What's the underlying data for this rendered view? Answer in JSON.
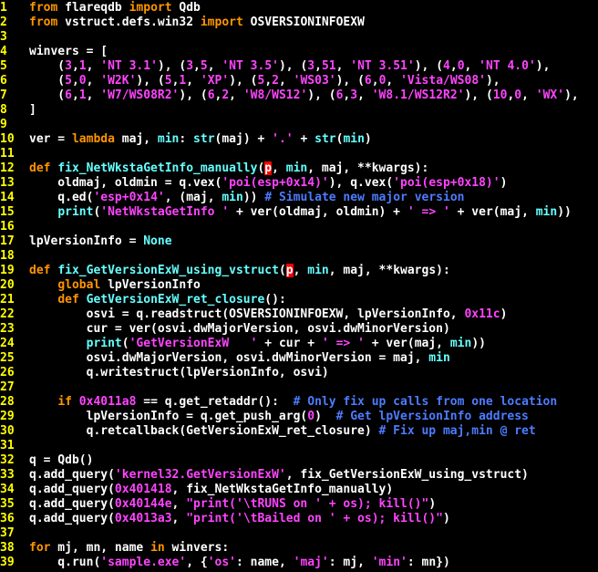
{
  "editor": {
    "background": "#000000",
    "colors": {
      "line_number": "#ffff00",
      "keyword": "#ff9500",
      "string": "#ff44ff",
      "function": "#66ffff",
      "comment": "#4d7cff",
      "text": "#ffffff",
      "cursor": "#ff0000"
    },
    "lines": [
      {
        "n": "1",
        "tokens": [
          {
            "t": "from",
            "c": "kw"
          },
          {
            "t": " flareqdb ",
            "c": "nm"
          },
          {
            "t": "import",
            "c": "kw"
          },
          {
            "t": " Qdb",
            "c": "nm"
          }
        ]
      },
      {
        "n": "2",
        "tokens": [
          {
            "t": "from",
            "c": "kw"
          },
          {
            "t": " vstruct.defs.win32 ",
            "c": "nm"
          },
          {
            "t": "import",
            "c": "kw"
          },
          {
            "t": " OSVERSIONINFOEXW",
            "c": "nm"
          }
        ]
      },
      {
        "n": "3",
        "tokens": []
      },
      {
        "n": "4",
        "tokens": [
          {
            "t": "winvers = [",
            "c": "nm"
          }
        ]
      },
      {
        "n": "5",
        "tokens": [
          {
            "t": "    (",
            "c": "nm"
          },
          {
            "t": "3",
            "c": "num"
          },
          {
            "t": ",",
            "c": "nm"
          },
          {
            "t": "1",
            "c": "num"
          },
          {
            "t": ", ",
            "c": "nm"
          },
          {
            "t": "'NT 3.1'",
            "c": "str"
          },
          {
            "t": "), (",
            "c": "nm"
          },
          {
            "t": "3",
            "c": "num"
          },
          {
            "t": ",",
            "c": "nm"
          },
          {
            "t": "5",
            "c": "num"
          },
          {
            "t": ", ",
            "c": "nm"
          },
          {
            "t": "'NT 3.5'",
            "c": "str"
          },
          {
            "t": "), (",
            "c": "nm"
          },
          {
            "t": "3",
            "c": "num"
          },
          {
            "t": ",",
            "c": "nm"
          },
          {
            "t": "51",
            "c": "num"
          },
          {
            "t": ", ",
            "c": "nm"
          },
          {
            "t": "'NT 3.51'",
            "c": "str"
          },
          {
            "t": "), (",
            "c": "nm"
          },
          {
            "t": "4",
            "c": "num"
          },
          {
            "t": ",",
            "c": "nm"
          },
          {
            "t": "0",
            "c": "num"
          },
          {
            "t": ", ",
            "c": "nm"
          },
          {
            "t": "'NT 4.0'",
            "c": "str"
          },
          {
            "t": "),",
            "c": "nm"
          }
        ]
      },
      {
        "n": "6",
        "tokens": [
          {
            "t": "    (",
            "c": "nm"
          },
          {
            "t": "5",
            "c": "num"
          },
          {
            "t": ",",
            "c": "nm"
          },
          {
            "t": "0",
            "c": "num"
          },
          {
            "t": ", ",
            "c": "nm"
          },
          {
            "t": "'W2K'",
            "c": "str"
          },
          {
            "t": "), (",
            "c": "nm"
          },
          {
            "t": "5",
            "c": "num"
          },
          {
            "t": ",",
            "c": "nm"
          },
          {
            "t": "1",
            "c": "num"
          },
          {
            "t": ", ",
            "c": "nm"
          },
          {
            "t": "'XP'",
            "c": "str"
          },
          {
            "t": "), (",
            "c": "nm"
          },
          {
            "t": "5",
            "c": "num"
          },
          {
            "t": ",",
            "c": "nm"
          },
          {
            "t": "2",
            "c": "num"
          },
          {
            "t": ", ",
            "c": "nm"
          },
          {
            "t": "'WS03'",
            "c": "str"
          },
          {
            "t": "), (",
            "c": "nm"
          },
          {
            "t": "6",
            "c": "num"
          },
          {
            "t": ",",
            "c": "nm"
          },
          {
            "t": "0",
            "c": "num"
          },
          {
            "t": ", ",
            "c": "nm"
          },
          {
            "t": "'Vista/WS08'",
            "c": "str"
          },
          {
            "t": "),",
            "c": "nm"
          }
        ]
      },
      {
        "n": "7",
        "tokens": [
          {
            "t": "    (",
            "c": "nm"
          },
          {
            "t": "6",
            "c": "num"
          },
          {
            "t": ",",
            "c": "nm"
          },
          {
            "t": "1",
            "c": "num"
          },
          {
            "t": ", ",
            "c": "nm"
          },
          {
            "t": "'W7/WS08R2'",
            "c": "str"
          },
          {
            "t": "), (",
            "c": "nm"
          },
          {
            "t": "6",
            "c": "num"
          },
          {
            "t": ",",
            "c": "nm"
          },
          {
            "t": "2",
            "c": "num"
          },
          {
            "t": ", ",
            "c": "nm"
          },
          {
            "t": "'W8/WS12'",
            "c": "str"
          },
          {
            "t": "), (",
            "c": "nm"
          },
          {
            "t": "6",
            "c": "num"
          },
          {
            "t": ",",
            "c": "nm"
          },
          {
            "t": "3",
            "c": "num"
          },
          {
            "t": ", ",
            "c": "nm"
          },
          {
            "t": "'W8.1/WS12R2'",
            "c": "str"
          },
          {
            "t": "), (",
            "c": "nm"
          },
          {
            "t": "10",
            "c": "num"
          },
          {
            "t": ",",
            "c": "nm"
          },
          {
            "t": "0",
            "c": "num"
          },
          {
            "t": ", ",
            "c": "nm"
          },
          {
            "t": "'WX'",
            "c": "str"
          },
          {
            "t": "),",
            "c": "nm"
          }
        ]
      },
      {
        "n": "8",
        "tokens": [
          {
            "t": "]",
            "c": "nm"
          }
        ]
      },
      {
        "n": "9",
        "tokens": []
      },
      {
        "n": "10",
        "tokens": [
          {
            "t": "ver = ",
            "c": "nm"
          },
          {
            "t": "lambda",
            "c": "kw"
          },
          {
            "t": " maj, ",
            "c": "nm"
          },
          {
            "t": "min",
            "c": "fn"
          },
          {
            "t": ": ",
            "c": "nm"
          },
          {
            "t": "str",
            "c": "fn"
          },
          {
            "t": "(maj) + ",
            "c": "nm"
          },
          {
            "t": "'.'",
            "c": "str"
          },
          {
            "t": " + ",
            "c": "nm"
          },
          {
            "t": "str",
            "c": "fn"
          },
          {
            "t": "(",
            "c": "nm"
          },
          {
            "t": "min",
            "c": "fn"
          },
          {
            "t": ")",
            "c": "nm"
          }
        ]
      },
      {
        "n": "11",
        "tokens": []
      },
      {
        "n": "12",
        "tokens": [
          {
            "t": "def",
            "c": "kw"
          },
          {
            "t": " ",
            "c": "nm"
          },
          {
            "t": "fix_NetWkstaGetInfo_manually",
            "c": "fn"
          },
          {
            "t": "(",
            "c": "nm"
          },
          {
            "t": "p",
            "c": "cur"
          },
          {
            "t": ", ",
            "c": "nm"
          },
          {
            "t": "min",
            "c": "fn"
          },
          {
            "t": ", maj, **kwargs):",
            "c": "nm"
          }
        ]
      },
      {
        "n": "13",
        "tokens": [
          {
            "t": "    oldmaj, oldmin = q.vex(",
            "c": "nm"
          },
          {
            "t": "'poi(esp+0x14)'",
            "c": "str"
          },
          {
            "t": "), q.vex(",
            "c": "nm"
          },
          {
            "t": "'poi(esp+0x18)'",
            "c": "str"
          },
          {
            "t": ")",
            "c": "nm"
          }
        ]
      },
      {
        "n": "14",
        "tokens": [
          {
            "t": "    q.ed(",
            "c": "nm"
          },
          {
            "t": "'esp+0x14'",
            "c": "str"
          },
          {
            "t": ", (maj, ",
            "c": "nm"
          },
          {
            "t": "min",
            "c": "fn"
          },
          {
            "t": ")) ",
            "c": "nm"
          },
          {
            "t": "# Simulate new major version",
            "c": "cm"
          }
        ]
      },
      {
        "n": "15",
        "tokens": [
          {
            "t": "    ",
            "c": "nm"
          },
          {
            "t": "print",
            "c": "fn"
          },
          {
            "t": "(",
            "c": "nm"
          },
          {
            "t": "'NetWkstaGetInfo '",
            "c": "str"
          },
          {
            "t": " + ver(oldmaj, oldmin) + ",
            "c": "nm"
          },
          {
            "t": "' => '",
            "c": "str"
          },
          {
            "t": " + ver(maj, ",
            "c": "nm"
          },
          {
            "t": "min",
            "c": "fn"
          },
          {
            "t": "))",
            "c": "nm"
          }
        ]
      },
      {
        "n": "16",
        "tokens": []
      },
      {
        "n": "17",
        "tokens": [
          {
            "t": "lpVersionInfo = ",
            "c": "nm"
          },
          {
            "t": "None",
            "c": "fn"
          }
        ]
      },
      {
        "n": "18",
        "tokens": []
      },
      {
        "n": "19",
        "tokens": [
          {
            "t": "def",
            "c": "kw"
          },
          {
            "t": " ",
            "c": "nm"
          },
          {
            "t": "fix_GetVersionExW_using_vstruct",
            "c": "fn"
          },
          {
            "t": "(",
            "c": "nm"
          },
          {
            "t": "p",
            "c": "cur"
          },
          {
            "t": ", ",
            "c": "nm"
          },
          {
            "t": "min",
            "c": "fn"
          },
          {
            "t": ", maj, **kwargs):",
            "c": "nm"
          }
        ]
      },
      {
        "n": "20",
        "tokens": [
          {
            "t": "    ",
            "c": "nm"
          },
          {
            "t": "global",
            "c": "kw"
          },
          {
            "t": " lpVersionInfo",
            "c": "nm"
          }
        ]
      },
      {
        "n": "21",
        "tokens": [
          {
            "t": "    ",
            "c": "nm"
          },
          {
            "t": "def",
            "c": "kw"
          },
          {
            "t": " ",
            "c": "nm"
          },
          {
            "t": "GetVersionExW_ret_closure",
            "c": "fn"
          },
          {
            "t": "():",
            "c": "nm"
          }
        ]
      },
      {
        "n": "22",
        "tokens": [
          {
            "t": "        osvi = q.readstruct(OSVERSIONINFOEXW, lpVersionInfo, ",
            "c": "nm"
          },
          {
            "t": "0x11c",
            "c": "num"
          },
          {
            "t": ")",
            "c": "nm"
          }
        ]
      },
      {
        "n": "23",
        "tokens": [
          {
            "t": "        cur = ver(osvi.dwMajorVersion, osvi.dwMinorVersion)",
            "c": "nm"
          }
        ]
      },
      {
        "n": "24",
        "tokens": [
          {
            "t": "        ",
            "c": "nm"
          },
          {
            "t": "print",
            "c": "fn"
          },
          {
            "t": "(",
            "c": "nm"
          },
          {
            "t": "'GetVersionExW   '",
            "c": "str"
          },
          {
            "t": " + cur + ",
            "c": "nm"
          },
          {
            "t": "' => '",
            "c": "str"
          },
          {
            "t": " + ver(maj, ",
            "c": "nm"
          },
          {
            "t": "min",
            "c": "fn"
          },
          {
            "t": "))",
            "c": "nm"
          }
        ]
      },
      {
        "n": "25",
        "tokens": [
          {
            "t": "        osvi.dwMajorVersion, osvi.dwMinorVersion = maj, ",
            "c": "nm"
          },
          {
            "t": "min",
            "c": "fn"
          }
        ]
      },
      {
        "n": "26",
        "tokens": [
          {
            "t": "        q.writestruct(lpVersionInfo, osvi)",
            "c": "nm"
          }
        ]
      },
      {
        "n": "27",
        "tokens": []
      },
      {
        "n": "28",
        "tokens": [
          {
            "t": "    ",
            "c": "nm"
          },
          {
            "t": "if",
            "c": "kw"
          },
          {
            "t": " ",
            "c": "nm"
          },
          {
            "t": "0x4011a8",
            "c": "num"
          },
          {
            "t": " == q.get_retaddr():  ",
            "c": "nm"
          },
          {
            "t": "# Only fix up calls from one location",
            "c": "cm"
          }
        ]
      },
      {
        "n": "29",
        "tokens": [
          {
            "t": "        lpVersionInfo = q.get_push_arg(",
            "c": "nm"
          },
          {
            "t": "0",
            "c": "num"
          },
          {
            "t": ")  ",
            "c": "nm"
          },
          {
            "t": "# Get lpVersionInfo address",
            "c": "cm"
          }
        ]
      },
      {
        "n": "30",
        "tokens": [
          {
            "t": "        q.retcallback(GetVersionExW_ret_closure) ",
            "c": "nm"
          },
          {
            "t": "# Fix up maj,min @ ret",
            "c": "cm"
          }
        ]
      },
      {
        "n": "31",
        "tokens": []
      },
      {
        "n": "32",
        "tokens": [
          {
            "t": "q = Qdb()",
            "c": "nm"
          }
        ]
      },
      {
        "n": "33",
        "tokens": [
          {
            "t": "q.add_query(",
            "c": "nm"
          },
          {
            "t": "'kernel32.GetVersionExW'",
            "c": "str"
          },
          {
            "t": ", fix_GetVersionExW_using_vstruct)",
            "c": "nm"
          }
        ]
      },
      {
        "n": "34",
        "tokens": [
          {
            "t": "q.add_query(",
            "c": "nm"
          },
          {
            "t": "0x401418",
            "c": "num"
          },
          {
            "t": ", fix_NetWkstaGetInfo_manually)",
            "c": "nm"
          }
        ]
      },
      {
        "n": "35",
        "tokens": [
          {
            "t": "q.add_query(",
            "c": "nm"
          },
          {
            "t": "0x40144e",
            "c": "num"
          },
          {
            "t": ", ",
            "c": "nm"
          },
          {
            "t": "\"print('\\tRUNS on ' + os); kill()\"",
            "c": "str"
          },
          {
            "t": ")",
            "c": "nm"
          }
        ]
      },
      {
        "n": "36",
        "tokens": [
          {
            "t": "q.add_query(",
            "c": "nm"
          },
          {
            "t": "0x4013a3",
            "c": "num"
          },
          {
            "t": ", ",
            "c": "nm"
          },
          {
            "t": "\"print('\\tBailed on ' + os); kill()\"",
            "c": "str"
          },
          {
            "t": ")",
            "c": "nm"
          }
        ]
      },
      {
        "n": "37",
        "tokens": []
      },
      {
        "n": "38",
        "tokens": [
          {
            "t": "for",
            "c": "kw"
          },
          {
            "t": " mj, mn, name ",
            "c": "nm"
          },
          {
            "t": "in",
            "c": "kw"
          },
          {
            "t": " winvers:",
            "c": "nm"
          }
        ]
      },
      {
        "n": "39",
        "tokens": [
          {
            "t": "    q.run(",
            "c": "nm"
          },
          {
            "t": "'sample.exe'",
            "c": "str"
          },
          {
            "t": ", {",
            "c": "nm"
          },
          {
            "t": "'os'",
            "c": "str"
          },
          {
            "t": ": name, ",
            "c": "nm"
          },
          {
            "t": "'maj'",
            "c": "str"
          },
          {
            "t": ": mj, ",
            "c": "nm"
          },
          {
            "t": "'min'",
            "c": "str"
          },
          {
            "t": ": mn})",
            "c": "nm"
          }
        ]
      }
    ]
  }
}
